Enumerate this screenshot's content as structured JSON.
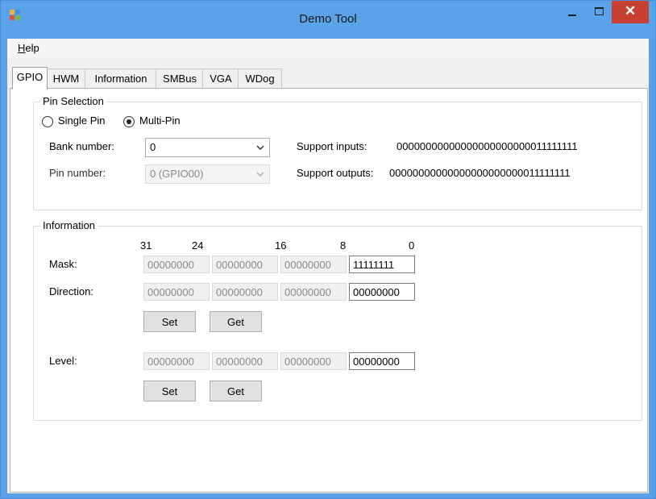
{
  "window": {
    "title": "Demo Tool",
    "close_glyph": "✕"
  },
  "menu": {
    "help_letter": "H",
    "help_rest": "elp"
  },
  "tabs": [
    "GPIO",
    "HWM",
    "Information",
    "SMBus",
    "VGA",
    "WDog"
  ],
  "active_tab": "GPIO",
  "pin_selection": {
    "legend": "Pin Selection",
    "single_pin_label": "Single Pin",
    "multi_pin_label": "Multi-Pin",
    "selected_mode": "Multi-Pin",
    "bank_label": "Bank number:",
    "bank_value": "0",
    "pin_label": "Pin number:",
    "pin_value": "0 (GPIO00)",
    "support_inputs_label": "Support inputs:",
    "support_inputs_value": "00000000000000000000000011111111",
    "support_outputs_label": "Support outputs:",
    "support_outputs_value": "00000000000000000000000011111111"
  },
  "information": {
    "legend": "Information",
    "bit_labels": [
      "31",
      "24",
      "16",
      "8",
      "0"
    ],
    "mask": {
      "label": "Mask:",
      "values": [
        "00000000",
        "00000000",
        "00000000",
        "11111111"
      ]
    },
    "direction": {
      "label": "Direction:",
      "values": [
        "00000000",
        "00000000",
        "00000000",
        "00000000"
      ]
    },
    "level": {
      "label": "Level:",
      "values": [
        "00000000",
        "00000000",
        "00000000",
        "00000000"
      ]
    },
    "set_label": "Set",
    "get_label": "Get"
  },
  "colors": {
    "titlebar": "#5ba3e8",
    "close_button": "#c84031"
  }
}
